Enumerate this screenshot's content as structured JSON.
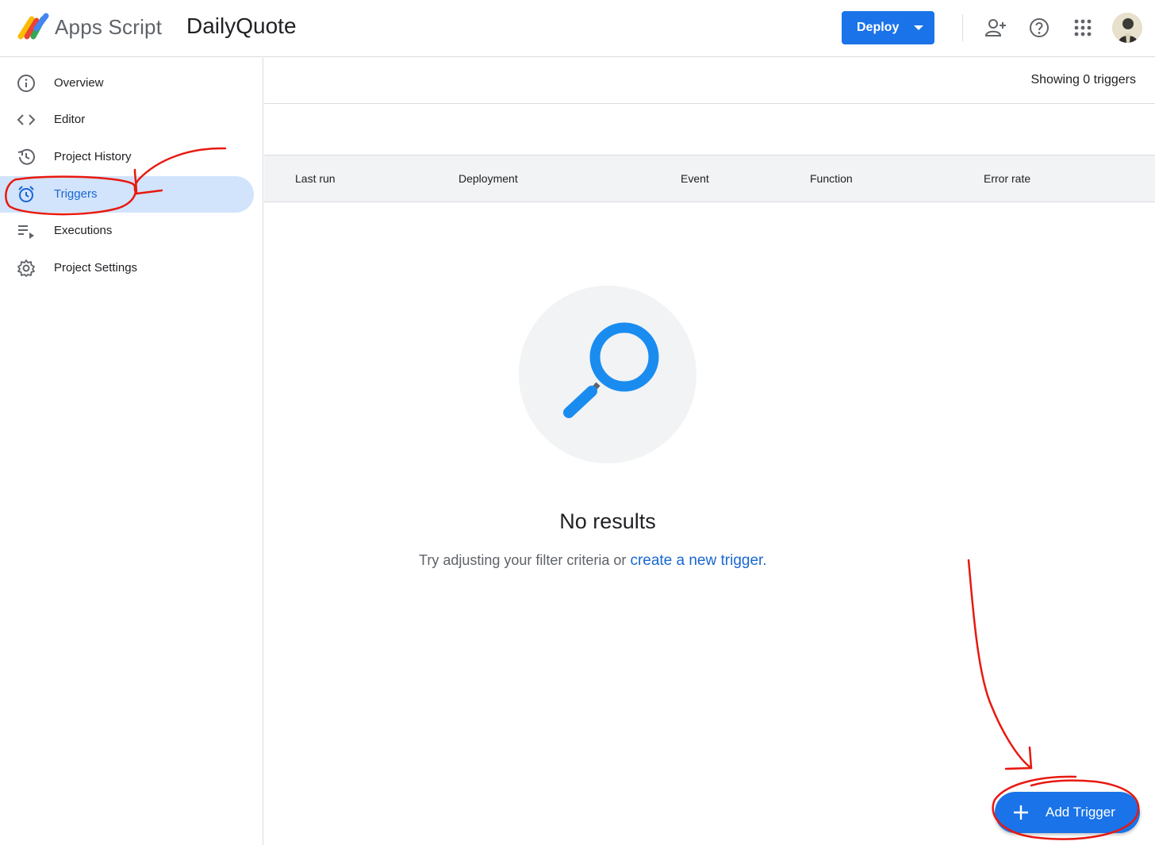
{
  "header": {
    "brand": "Apps Script",
    "project_title": "DailyQuote",
    "deploy_label": "Deploy",
    "icons": [
      "add-person-icon",
      "help-icon",
      "apps-grid-icon"
    ]
  },
  "sidebar": {
    "items": [
      {
        "label": "Overview",
        "icon": "info-icon",
        "active": false
      },
      {
        "label": "Editor",
        "icon": "code-icon",
        "active": false
      },
      {
        "label": "Project History",
        "icon": "history-icon",
        "active": false
      },
      {
        "label": "Triggers",
        "icon": "alarm-icon",
        "active": true
      },
      {
        "label": "Executions",
        "icon": "playlist-play-icon",
        "active": false
      },
      {
        "label": "Project Settings",
        "icon": "gear-icon",
        "active": false
      }
    ]
  },
  "main": {
    "showing": "Showing 0 triggers",
    "columns": [
      "Last run",
      "Deployment",
      "Event",
      "Function",
      "Error rate"
    ],
    "empty_title": "No results",
    "empty_hint": "Try adjusting your filter criteria or",
    "empty_link": "create a new trigger."
  },
  "fab": {
    "label": "Add Trigger"
  },
  "colors": {
    "accent": "#1a73e8",
    "active_bg": "#d2e3fc",
    "annotation": "#e8190f"
  }
}
